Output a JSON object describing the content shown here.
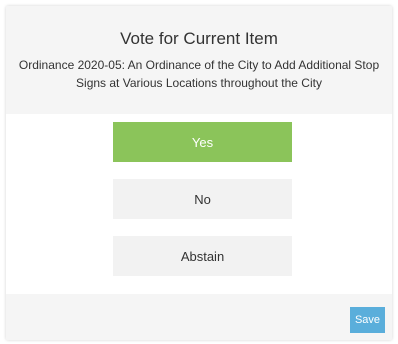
{
  "dialog": {
    "title": "Vote for Current Item",
    "subtitle": "Ordinance 2020-05: An Ordinance of the City to Add Additional Stop Signs at Various Locations throughout the City"
  },
  "options": [
    {
      "label": "Yes",
      "selected": true
    },
    {
      "label": "No",
      "selected": false
    },
    {
      "label": "Abstain",
      "selected": false
    }
  ],
  "footer": {
    "save_label": "Save"
  },
  "colors": {
    "selected": "#8bc45a",
    "option_bg": "#f2f2f2",
    "header_bg": "#f5f5f5",
    "save_bg": "#5aaedb"
  }
}
